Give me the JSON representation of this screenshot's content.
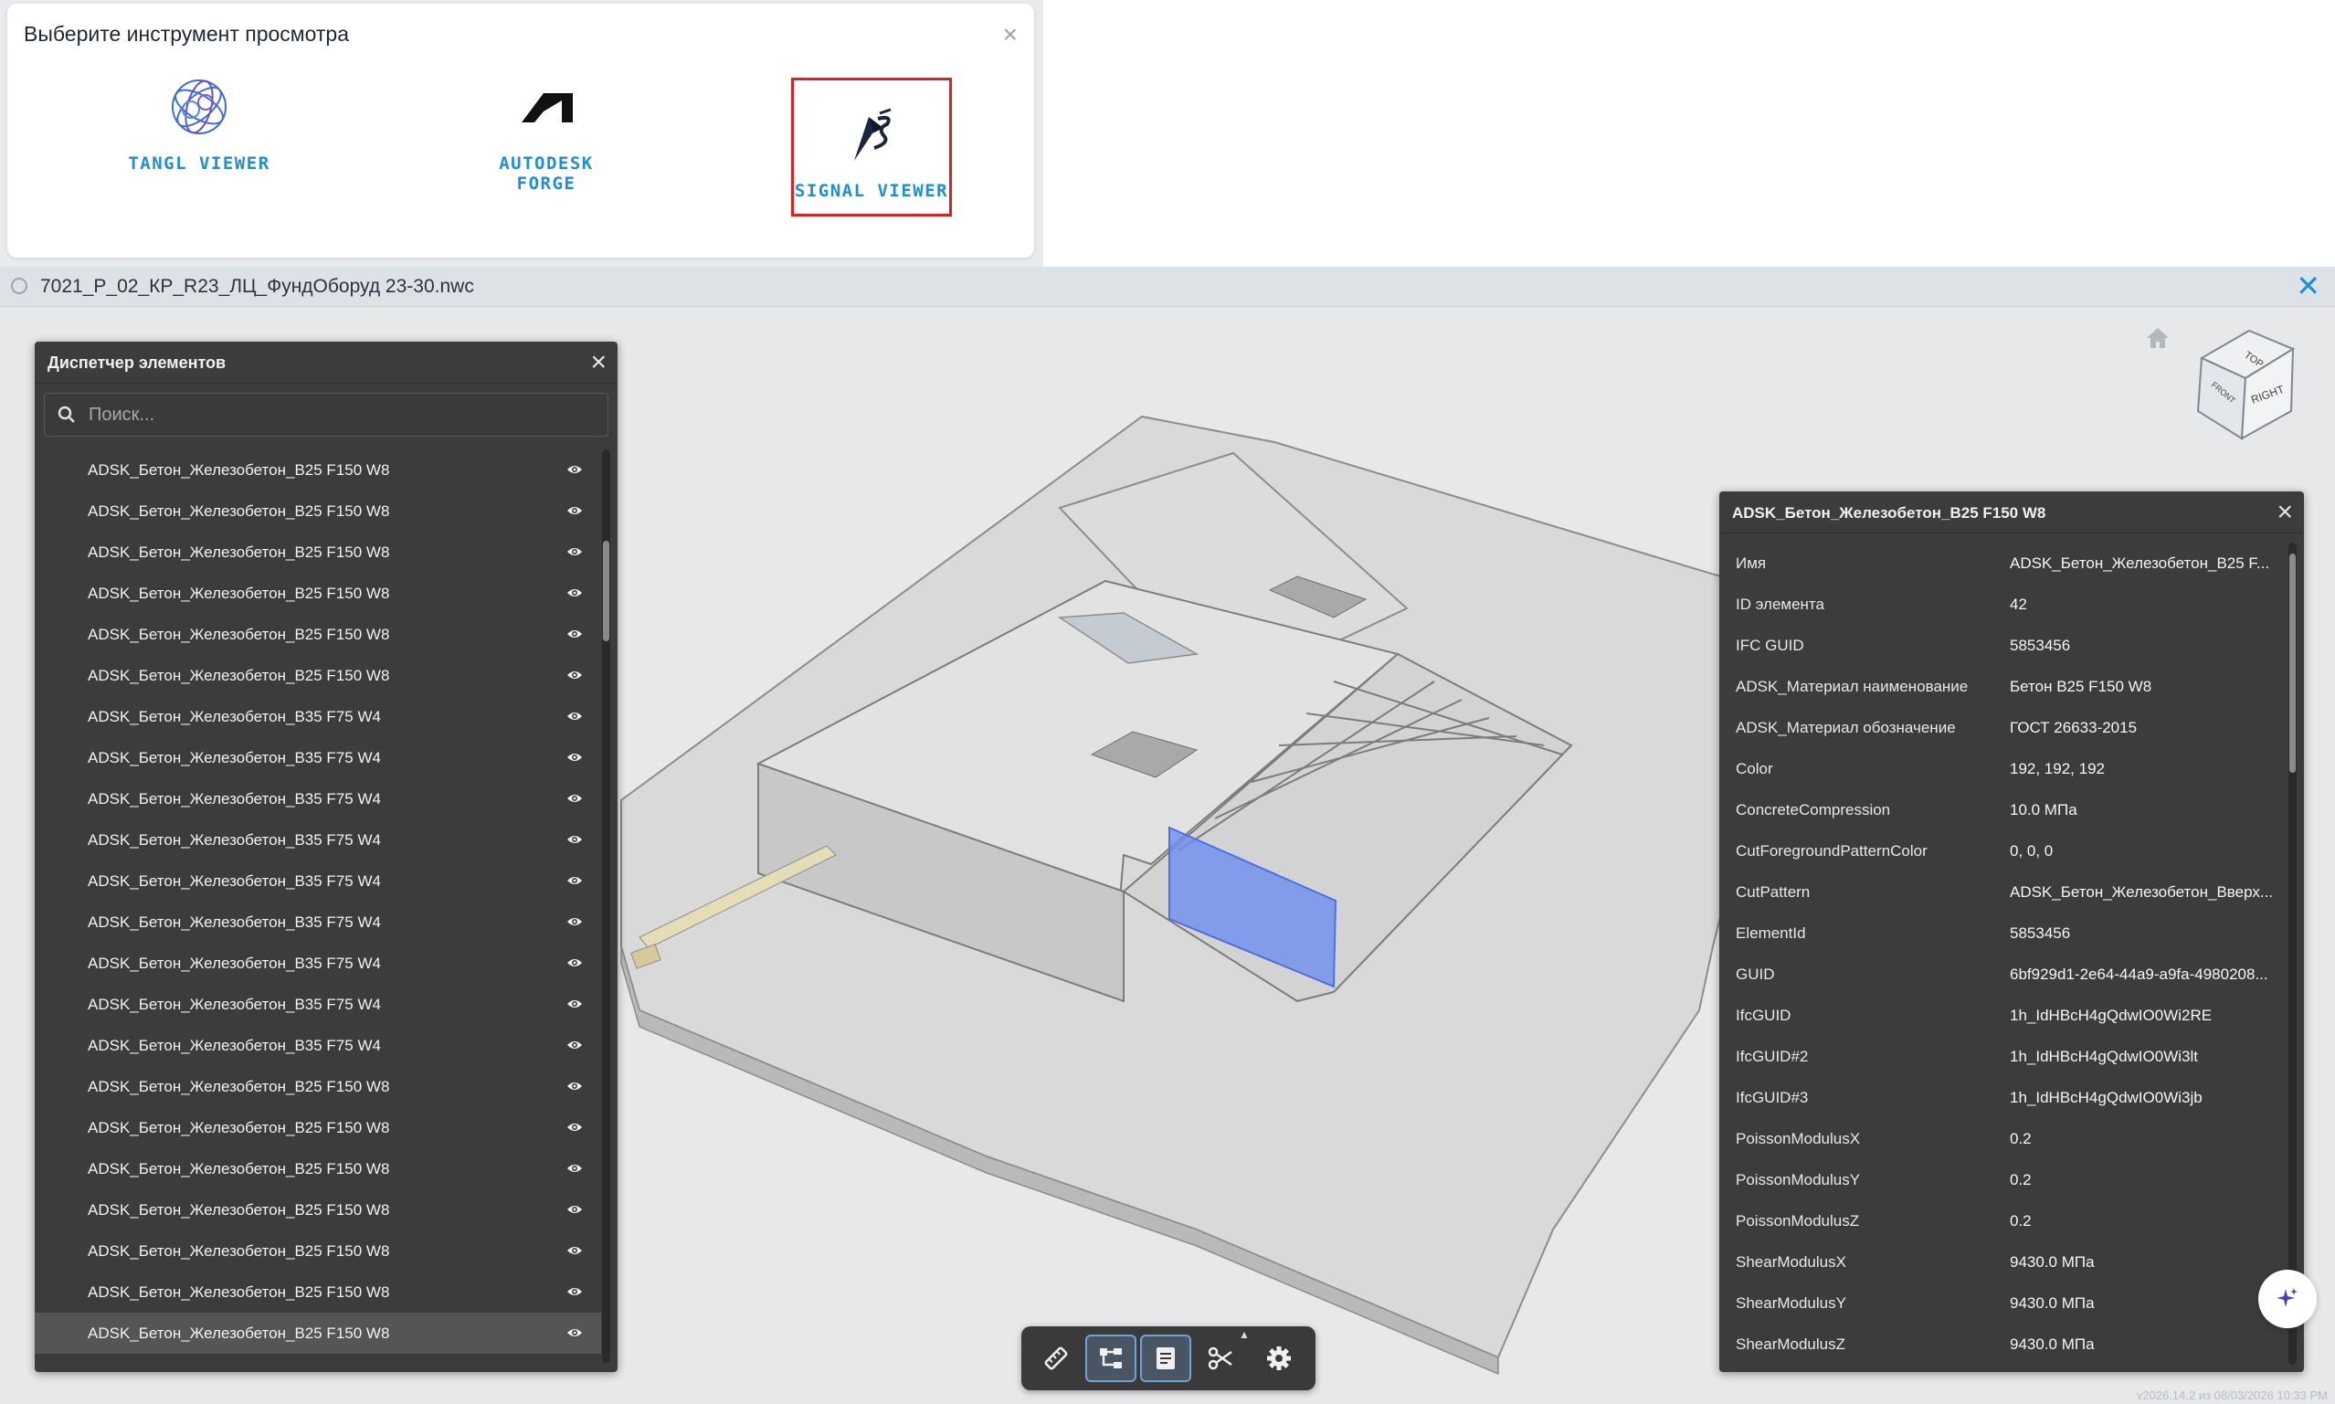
{
  "chooser": {
    "title": "Выберите инструмент просмотра",
    "close": "×",
    "options": [
      {
        "label": "TANGL VIEWER",
        "icon": "tangl-logo-icon"
      },
      {
        "label": "AUTODESK FORGE",
        "icon": "autodesk-logo-icon"
      },
      {
        "label": "SIGNAL VIEWER",
        "icon": "signal-logo-icon",
        "highlighted": true
      }
    ]
  },
  "file": {
    "name": "7021_Р_02_КР_R23_ЛЦ_ФундОборуд 23-30.nwc",
    "close": "✕"
  },
  "elements_panel": {
    "title": "Диспетчер элементов",
    "close": "×",
    "search_placeholder": "Поиск...",
    "items": [
      "ADSK_Бетон_Железобетон_B25 F150 W8",
      "ADSK_Бетон_Железобетон_B25 F150 W8",
      "ADSK_Бетон_Железобетон_B25 F150 W8",
      "ADSK_Бетон_Железобетон_B25 F150 W8",
      "ADSK_Бетон_Железобетон_B25 F150 W8",
      "ADSK_Бетон_Железобетон_B25 F150 W8",
      "ADSK_Бетон_Железобетон_B35 F75 W4",
      "ADSK_Бетон_Железобетон_B35 F75 W4",
      "ADSK_Бетон_Железобетон_B35 F75 W4",
      "ADSK_Бетон_Железобетон_B35 F75 W4",
      "ADSK_Бетон_Железобетон_B35 F75 W4",
      "ADSK_Бетон_Железобетон_B35 F75 W4",
      "ADSK_Бетон_Железобетон_B35 F75 W4",
      "ADSK_Бетон_Железобетон_B35 F75 W4",
      "ADSK_Бетон_Железобетон_B35 F75 W4",
      "ADSK_Бетон_Железобетон_B25 F150 W8",
      "ADSK_Бетон_Железобетон_B25 F150 W8",
      "ADSK_Бетон_Железобетон_B25 F150 W8",
      "ADSK_Бетон_Железобетон_B25 F150 W8",
      "ADSK_Бетон_Железобетон_B25 F150 W8",
      "ADSK_Бетон_Железобетон_B25 F150 W8",
      "ADSK_Бетон_Железобетон_B25 F150 W8"
    ],
    "selected_index": 21
  },
  "properties_panel": {
    "title": "ADSK_Бетон_Железобетон_B25 F150 W8",
    "close": "×",
    "rows": [
      {
        "name": "Имя",
        "value": "ADSK_Бетон_Железобетон_B25 F..."
      },
      {
        "name": "ID элемента",
        "value": "42"
      },
      {
        "name": "IFC GUID",
        "value": "5853456"
      },
      {
        "name": "ADSK_Материал наименование",
        "value": "Бетон B25 F150 W8"
      },
      {
        "name": "ADSK_Материал обозначение",
        "value": "ГОСТ 26633-2015"
      },
      {
        "name": "Color",
        "value": "192, 192, 192"
      },
      {
        "name": "ConcreteCompression",
        "value": "10.0 МПа"
      },
      {
        "name": "CutForegroundPatternColor",
        "value": "0, 0, 0"
      },
      {
        "name": "CutPattern",
        "value": "ADSK_Бетон_Железобетон_Вверх..."
      },
      {
        "name": "ElementId",
        "value": "5853456"
      },
      {
        "name": "GUID",
        "value": "6bf929d1-2e64-44a9-a9fa-4980208..."
      },
      {
        "name": "IfcGUID",
        "value": "1h_IdHBcH4gQdwIO0Wi2RE"
      },
      {
        "name": "IfcGUID#2",
        "value": "1h_IdHBcH4gQdwIO0Wi3lt"
      },
      {
        "name": "IfcGUID#3",
        "value": "1h_IdHBcH4gQdwIO0Wi3jb"
      },
      {
        "name": "PoissonModulusX",
        "value": "0.2"
      },
      {
        "name": "PoissonModulusY",
        "value": "0.2"
      },
      {
        "name": "PoissonModulusZ",
        "value": "0.2"
      },
      {
        "name": "ShearModulusX",
        "value": "9430.0 МПа"
      },
      {
        "name": "ShearModulusY",
        "value": "9430.0 МПа"
      },
      {
        "name": "ShearModulusZ",
        "value": "9430.0 МПа"
      }
    ]
  },
  "viewcube": {
    "top": "TOP",
    "front": "FRONT",
    "right": "RIGHT"
  },
  "toolbar": {
    "buttons": [
      {
        "name": "measure",
        "icon": "ruler-icon",
        "active": false
      },
      {
        "name": "model-tree",
        "icon": "tree-icon",
        "active": true
      },
      {
        "name": "properties",
        "icon": "properties-icon",
        "active": true
      },
      {
        "name": "section",
        "icon": "scissors-icon",
        "active": false
      },
      {
        "name": "settings",
        "icon": "gear-icon",
        "active": false
      }
    ]
  },
  "version": "v2026.14.2 из 08/03/2026 10:33 PM",
  "colors": {
    "accent": "#1e8fd6",
    "highlight_border": "#e02020",
    "panel_bg": "#3c3c3c",
    "selection": "#6f8ff0"
  }
}
